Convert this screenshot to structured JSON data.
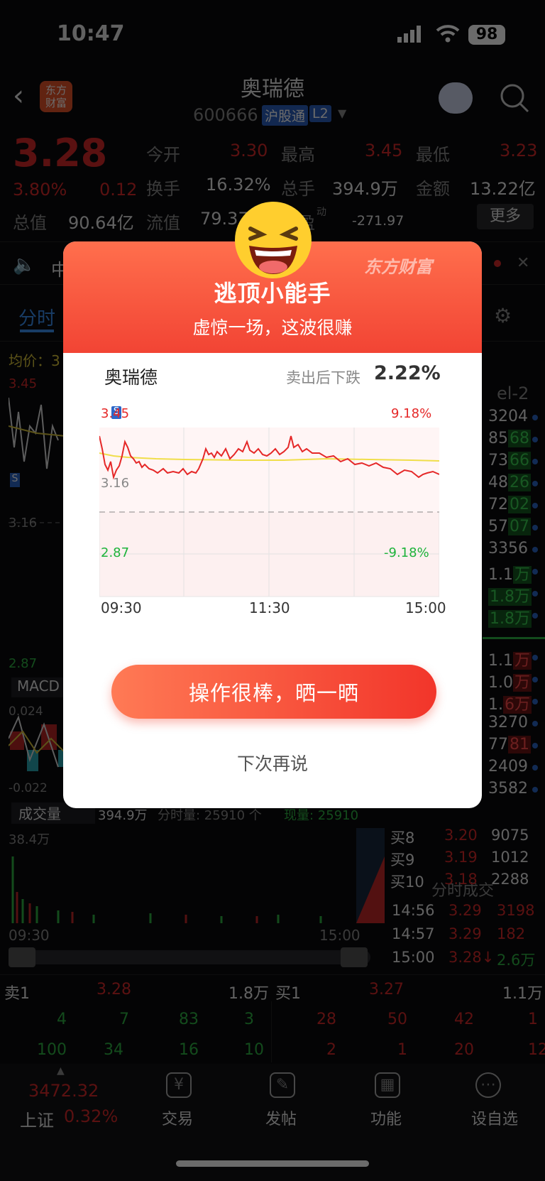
{
  "status_bar": {
    "time": "10:47",
    "battery": "98"
  },
  "header": {
    "title": "奥瑞德",
    "code": "600666",
    "badge_market": "沪股通",
    "badge_level": "L2"
  },
  "quote": {
    "price": "3.28",
    "pct": "3.80%",
    "chg": "0.12",
    "open_label": "今开",
    "open": "3.30",
    "high_label": "最高",
    "high": "3.45",
    "low_label": "最低",
    "low": "3.23",
    "turnover_label": "换手",
    "turnover": "16.32%",
    "vol_label": "总手",
    "vol": "394.9万",
    "amount_label": "金额",
    "amount": "13.22亿",
    "cap_label": "总值",
    "cap": "90.64亿",
    "float_label": "流值",
    "float": "79.37",
    "pe_label": "盈",
    "pe_sup": "动",
    "pe": "-271.97",
    "more": "更多"
  },
  "notice": {
    "text": "中"
  },
  "tabs": {
    "active": "分时"
  },
  "chart_bg": {
    "avg_label": "均价：3",
    "high": "3.45",
    "mid": "3.16",
    "low": "2.87",
    "macd": "MACD",
    "macd_hi": "0.024",
    "macd_lo": "-0.022",
    "vol_tab": "成交量",
    "vol_info": "394.9万",
    "vol_info2": "分时量: 25910 个",
    "vol_info3": "现量: 25910",
    "vol_axis": "38.4万",
    "t_start": "09:30",
    "t_end": "15:00",
    "level_tab": "el-2"
  },
  "book_right": [
    {
      "v": "3204",
      "hl": "",
      "c": "white"
    },
    {
      "v": "8568",
      "hl": "68",
      "c": "g"
    },
    {
      "v": "7366",
      "hl": "66",
      "c": "g"
    },
    {
      "v": "4826",
      "hl": "26",
      "c": "g"
    },
    {
      "v": "7202",
      "hl": "02",
      "c": "g"
    },
    {
      "v": "5707",
      "hl": "07",
      "c": "g"
    },
    {
      "v": "3356",
      "hl": "",
      "c": "white"
    },
    {
      "v": "1.1万",
      "hl": "万",
      "c": "g"
    },
    {
      "v": "1.8万",
      "hl": "1.8万",
      "c": "g"
    },
    {
      "v": "1.8万",
      "hl": "1.8万",
      "c": "g"
    }
  ],
  "book_right2": [
    {
      "v": "1.1万",
      "hl": "万",
      "c": "r"
    },
    {
      "v": "1.0万",
      "hl": "万",
      "c": "r"
    },
    {
      "v": "1.6万",
      "hl": "6万",
      "c": "r"
    },
    {
      "v": "3270",
      "hl": "",
      "c": "white"
    },
    {
      "v": "7781",
      "hl": "81",
      "c": "r"
    },
    {
      "v": "2409",
      "hl": "",
      "c": "white"
    },
    {
      "v": "3582",
      "hl": "",
      "c": "white"
    }
  ],
  "buy_levels": [
    {
      "label": "买8",
      "price": "3.20",
      "vol": "9075"
    },
    {
      "label": "买9",
      "price": "3.19",
      "vol": "1012"
    },
    {
      "label": "买10",
      "price": "3.18",
      "vol": "2288"
    }
  ],
  "ticks": {
    "title": "分时成交",
    "rows": [
      {
        "t": "14:56",
        "p": "3.29",
        "v": "3198"
      },
      {
        "t": "14:57",
        "p": "3.29",
        "v": "182"
      },
      {
        "t": "15:00",
        "p": "3.28↓",
        "v": "2.6万"
      }
    ]
  },
  "bottom_quote": {
    "sell1_label": "卖1",
    "sell1_price": "3.28",
    "sell1_vol": "1.8万",
    "buy1_label": "买1",
    "buy1_price": "3.27",
    "buy1_vol": "1.1万",
    "sell_row1": [
      "4",
      "7",
      "83",
      "3"
    ],
    "sell_row2": [
      "100",
      "34",
      "16",
      "10"
    ],
    "buy_row1": [
      "28",
      "50",
      "42",
      "1"
    ],
    "buy_row2": [
      "2",
      "1",
      "20",
      "12"
    ]
  },
  "bottom_nav": {
    "index_value": "3472.32",
    "index_name": "上证",
    "index_pct": "0.32%",
    "items": [
      {
        "label": "交易",
        "icon": "yen-exchange-icon"
      },
      {
        "label": "发帖",
        "icon": "edit-post-icon"
      },
      {
        "label": "功能",
        "icon": "grid-apps-icon"
      },
      {
        "label": "设自选",
        "icon": "more-dots-icon"
      }
    ]
  },
  "modal": {
    "brand": "东方财富",
    "title": "逃顶小能手",
    "subtitle": "虚惊一场，这波很赚",
    "stock": "奥瑞德",
    "drop_label": "卖出后下跌",
    "drop_value": "2.22%",
    "y_high": "3.45",
    "y_mid": "3.16",
    "y_low": "2.87",
    "pct_high": "9.18%",
    "pct_low": "-9.18%",
    "x_start": "09:30",
    "x_mid": "11:30",
    "x_end": "15:00",
    "share_button": "操作很棒，晒一晒",
    "later": "下次再说"
  },
  "colors": {
    "red": "#d62a2a",
    "green": "#2fb344",
    "accent": "#f24434"
  }
}
